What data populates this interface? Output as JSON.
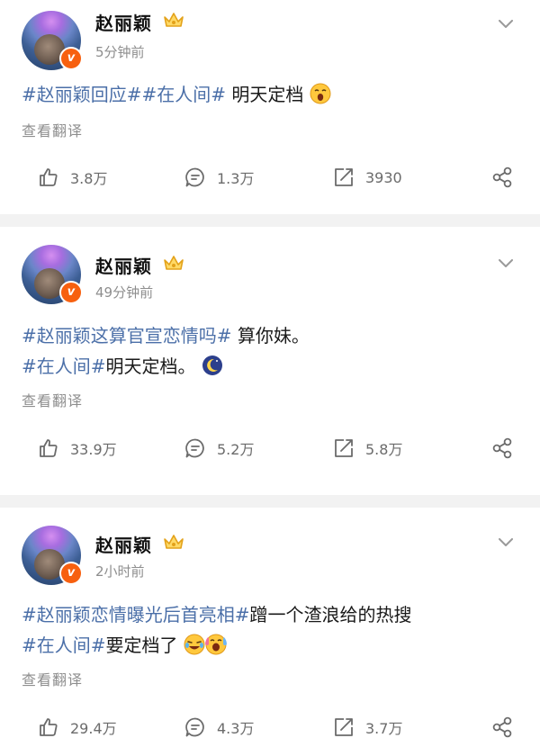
{
  "colors": {
    "accent_topic": "#4b6fa8",
    "meta_text": "#8e8e8e",
    "badge": "#f7600f"
  },
  "translate_label": "查看翻译",
  "posts": [
    {
      "username": "赵丽颖",
      "time": "5分钟前",
      "lines": [
        {
          "topics": [
            "#赵丽颖回应#",
            "#在人间#"
          ],
          "text": " 明天定档",
          "emojis": [
            "yawn-emoji"
          ]
        }
      ],
      "stats": {
        "likes": "3.8万",
        "comments": "1.3万",
        "reposts": "3930"
      }
    },
    {
      "username": "赵丽颖",
      "time": "49分钟前",
      "lines": [
        {
          "topics": [
            "#赵丽颖这算官宣恋情吗#"
          ],
          "text": " 算你妹。",
          "emojis": []
        },
        {
          "topics": [
            "#在人间#"
          ],
          "text": "明天定档。",
          "emojis": [
            "moon-emoji"
          ]
        }
      ],
      "stats": {
        "likes": "33.9万",
        "comments": "5.2万",
        "reposts": "5.8万"
      }
    },
    {
      "username": "赵丽颖",
      "time": "2小时前",
      "lines": [
        {
          "topics": [
            "#赵丽颖恋情曝光后首亮相#"
          ],
          "text": "蹭一个渣浪给的热搜",
          "emojis": []
        },
        {
          "topics": [
            "#在人间#"
          ],
          "text": "要定档了",
          "emojis": [
            "laugh-cry-emoji",
            "cheer-emoji"
          ]
        }
      ],
      "stats": {
        "likes": "29.4万",
        "comments": "4.3万",
        "reposts": "3.7万"
      }
    }
  ]
}
